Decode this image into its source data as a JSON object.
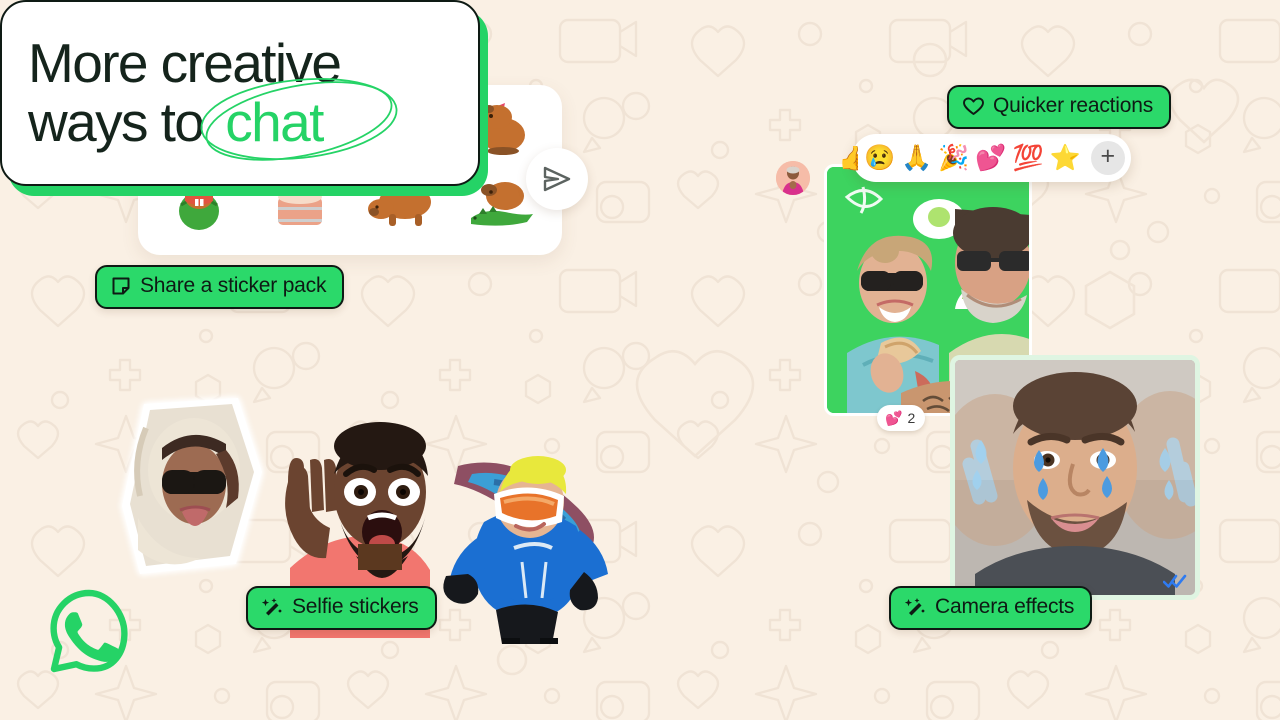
{
  "brand": {
    "name": "WhatsApp",
    "logo_icon": "whatsapp-logo-icon",
    "green": "#25D366",
    "pill_green": "#2BD96A",
    "background": "#FAF0E4",
    "ink": "#15241C"
  },
  "headline": {
    "line1": "More creative",
    "line2": "ways to",
    "highlight": "chat"
  },
  "pills": [
    {
      "id": "share-sticker-pack",
      "glyph": "🏷",
      "icon_name": "sticker-icon",
      "label": "Share a sticker pack"
    },
    {
      "id": "quicker-reactions",
      "glyph": "♡",
      "icon_name": "heart-outline-icon",
      "label": "Quicker reactions"
    },
    {
      "id": "selfie-stickers",
      "glyph": "✨",
      "icon_name": "magic-wand-icon",
      "label": "Selfie stickers"
    },
    {
      "id": "camera-effects",
      "glyph": "✨",
      "icon_name": "magic-wand-icon",
      "label": "Camera effects"
    }
  ],
  "sticker_panel": {
    "send_icon": "send-icon",
    "stickers": [
      {
        "name": "capybara-cuddle-sticker",
        "glyph": "🦫",
        "badge": "💗"
      },
      {
        "name": "capybara-taco-sticker",
        "glyph": "🦫",
        "badge": ""
      },
      {
        "name": "capybara-trio-sticker",
        "glyph": "🦫",
        "badge": ""
      },
      {
        "name": "capybara-sitting-sticker",
        "glyph": "🦫",
        "badge": ""
      },
      {
        "name": "capybara-watermelon-sticker",
        "glyph": "🍉",
        "badge": ""
      },
      {
        "name": "capybara-hot-tub-sticker",
        "glyph": "🛁",
        "badge": ""
      },
      {
        "name": "capybara-walking-sticker",
        "glyph": "🦫",
        "badge": ""
      },
      {
        "name": "capybara-crocodile-sticker",
        "glyph": "🐊",
        "badge": ""
      }
    ]
  },
  "reaction_bar": {
    "emojis": [
      {
        "name": "reaction-thumbs-up",
        "glyph": "👍"
      },
      {
        "name": "reaction-crying-face",
        "glyph": "😢"
      },
      {
        "name": "reaction-folded-hands",
        "glyph": "🙏"
      },
      {
        "name": "reaction-party-popper",
        "glyph": "🎉"
      },
      {
        "name": "reaction-two-hearts",
        "glyph": "💕"
      },
      {
        "name": "reaction-hundred-points",
        "glyph": "💯"
      },
      {
        "name": "reaction-star",
        "glyph": "⭐"
      }
    ],
    "more_label": "+"
  },
  "couple_photo": {
    "name": "couple-eating-photo",
    "alt": "Two people smiling, one wearing sunglasses, on a green fruit-doodle background",
    "reaction": {
      "glyph": "💕",
      "count": "2"
    }
  },
  "camera_photo": {
    "name": "camera-effect-video",
    "alt": "Man with blue teardrop camera effect stickers on his face",
    "ticks_icon": "double-check-icon",
    "ticks_color": "#2F7BF0"
  },
  "selfie_stickers": [
    {
      "name": "selfie-sticker-hooded-sunglasses",
      "alt": "Person in fluffy hood with dark sunglasses"
    },
    {
      "name": "selfie-sticker-shocked-face",
      "alt": "Person in pink shirt with shocked expression"
    },
    {
      "name": "selfie-sticker-snowboarder",
      "alt": "Snowboarder in blue jacket with goggles and yellow beanie"
    }
  ],
  "chat_avatar": {
    "name": "chat-avatar",
    "alt": "Profile photo of a person in a pink top"
  }
}
